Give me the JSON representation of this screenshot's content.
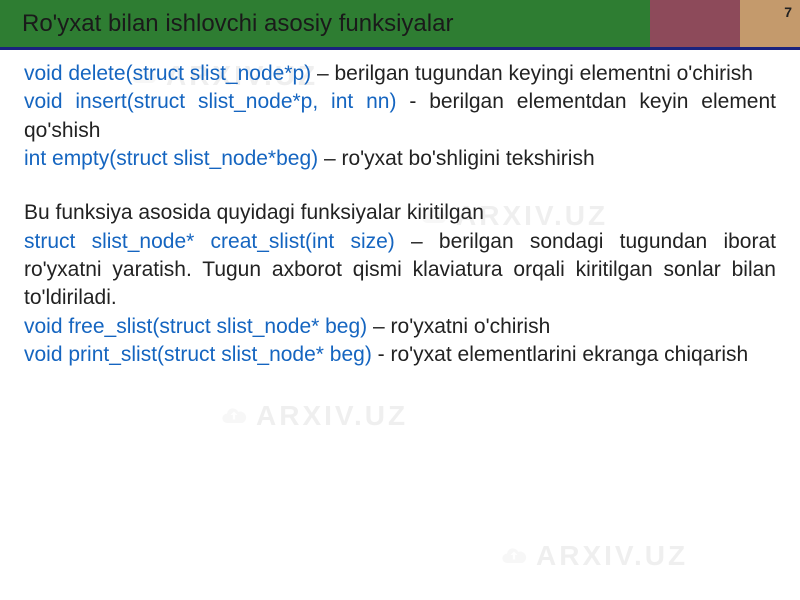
{
  "header": {
    "title": "Ro'yxat bilan ishlovchi asosiy funksiyalar",
    "page_number": "7"
  },
  "content": {
    "fn1": "void delete(struct slist_node*p)",
    "desc1": " – berilgan tugundan keyingi elementni o'chirish",
    "fn2": "void insert(struct slist_node*p, int nn)",
    "desc2": " - berilgan elementdan keyin element qo'shish",
    "fn3": "int empty(struct slist_node*beg)",
    "desc3": " – ro'yxat bo'shligini tekshirish",
    "intro2": "Bu funksiya asosida quyidagi funksiyalar kiritilgan",
    "fn4": "struct slist_node* creat_slist(int size)",
    "desc4": " – berilgan sondagi tugundan iborat ro'yxatni yaratish. Tugun axborot qismi klaviatura orqali kiritilgan sonlar bilan to'ldiriladi.",
    "fn5": "void free_slist(struct slist_node* beg)",
    "desc5": " – ro'yxatni o'chirish",
    "fn6": "void print_slist(struct slist_node* beg)",
    "desc6": " - ro'yxat elementlarini ekranga chiqarish"
  },
  "watermark": {
    "text": "ARXIV.UZ"
  }
}
